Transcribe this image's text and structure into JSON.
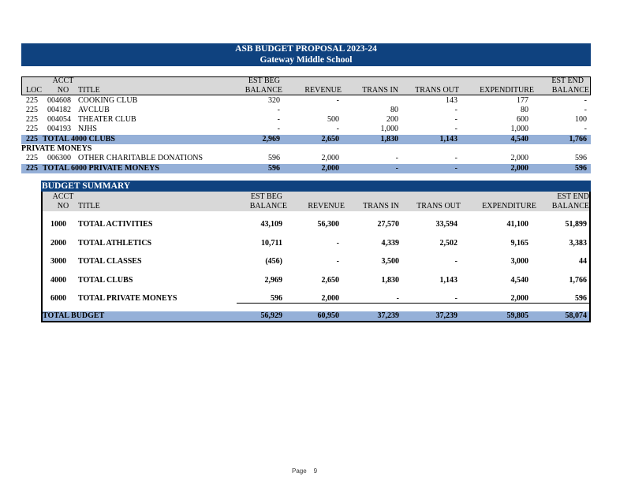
{
  "header": {
    "title": "ASB BUDGET PROPOSAL 2023-24",
    "school": "Gateway Middle School"
  },
  "columns": {
    "loc": "LOC",
    "acct_top": "ACCT",
    "acct_bottom": "NO",
    "title": "TITLE",
    "estbeg_top": "EST BEG",
    "estbeg_bottom": "BALANCE",
    "revenue": "REVENUE",
    "transin": "TRANS IN",
    "transout": "TRANS OUT",
    "expenditure": "EXPENDITURE",
    "estend_top": "EST END",
    "estend_bottom": "BALANCE"
  },
  "club_rows": [
    {
      "loc": "225",
      "acct": "004608",
      "title": "COOKING CLUB",
      "beg": "320",
      "rev": "-",
      "tin": "",
      "tout": "143",
      "exp": "177",
      "end": "-"
    },
    {
      "loc": "225",
      "acct": "004182",
      "title": "AVCLUB",
      "beg": "-",
      "rev": "",
      "tin": "80",
      "tout": "-",
      "exp": "80",
      "end": "-"
    },
    {
      "loc": "225",
      "acct": "004054",
      "title": "THEATER CLUB",
      "beg": "-",
      "rev": "500",
      "tin": "200",
      "tout": "-",
      "exp": "600",
      "end": "100"
    },
    {
      "loc": "225",
      "acct": "004193",
      "title": "NJHS",
      "beg": "-",
      "rev": "-",
      "tin": "1,000",
      "tout": "-",
      "exp": "1,000",
      "end": "-"
    }
  ],
  "club_total": {
    "loc": "225",
    "label": "TOTAL 4000 CLUBS",
    "beg": "2,969",
    "rev": "2,650",
    "tin": "1,830",
    "tout": "1,143",
    "exp": "4,540",
    "end": "1,766"
  },
  "private_section": "PRIVATE MONEYS",
  "private_rows": [
    {
      "loc": "225",
      "acct": "006300",
      "title": "OTHER CHARITABLE DONATIONS",
      "beg": "596",
      "rev": "2,000",
      "tin": "-",
      "tout": "-",
      "exp": "2,000",
      "end": "596"
    }
  ],
  "private_total": {
    "loc": "225",
    "label": "TOTAL 6000 PRIVATE MONEYS",
    "beg": "596",
    "rev": "2,000",
    "tin": "-",
    "tout": "-",
    "exp": "2,000",
    "end": "596"
  },
  "summary": {
    "title": "BUDGET SUMMARY",
    "rows": [
      {
        "acct": "1000",
        "title": "TOTAL ACTIVITIES",
        "beg": "43,109",
        "rev": "56,300",
        "tin": "27,570",
        "tout": "33,594",
        "exp": "41,100",
        "end": "51,899"
      },
      {
        "acct": "2000",
        "title": "TOTAL ATHLETICS",
        "beg": "10,711",
        "rev": "-",
        "tin": "4,339",
        "tout": "2,502",
        "exp": "9,165",
        "end": "3,383"
      },
      {
        "acct": "3000",
        "title": "TOTAL CLASSES",
        "beg": "(456)",
        "rev": "-",
        "tin": "3,500",
        "tout": "-",
        "exp": "3,000",
        "end": "44"
      },
      {
        "acct": "4000",
        "title": "TOTAL CLUBS",
        "beg": "2,969",
        "rev": "2,650",
        "tin": "1,830",
        "tout": "1,143",
        "exp": "4,540",
        "end": "1,766"
      },
      {
        "acct": "6000",
        "title": "TOTAL PRIVATE MONEYS",
        "beg": "596",
        "rev": "2,000",
        "tin": "-",
        "tout": "-",
        "exp": "2,000",
        "end": "596"
      }
    ],
    "total": {
      "label": "TOTAL BUDGET",
      "beg": "56,929",
      "rev": "60,950",
      "tin": "37,239",
      "tout": "37,239",
      "exp": "59,805",
      "end": "58,074"
    }
  },
  "footer": {
    "page_label": "Page",
    "page_number": "9"
  }
}
